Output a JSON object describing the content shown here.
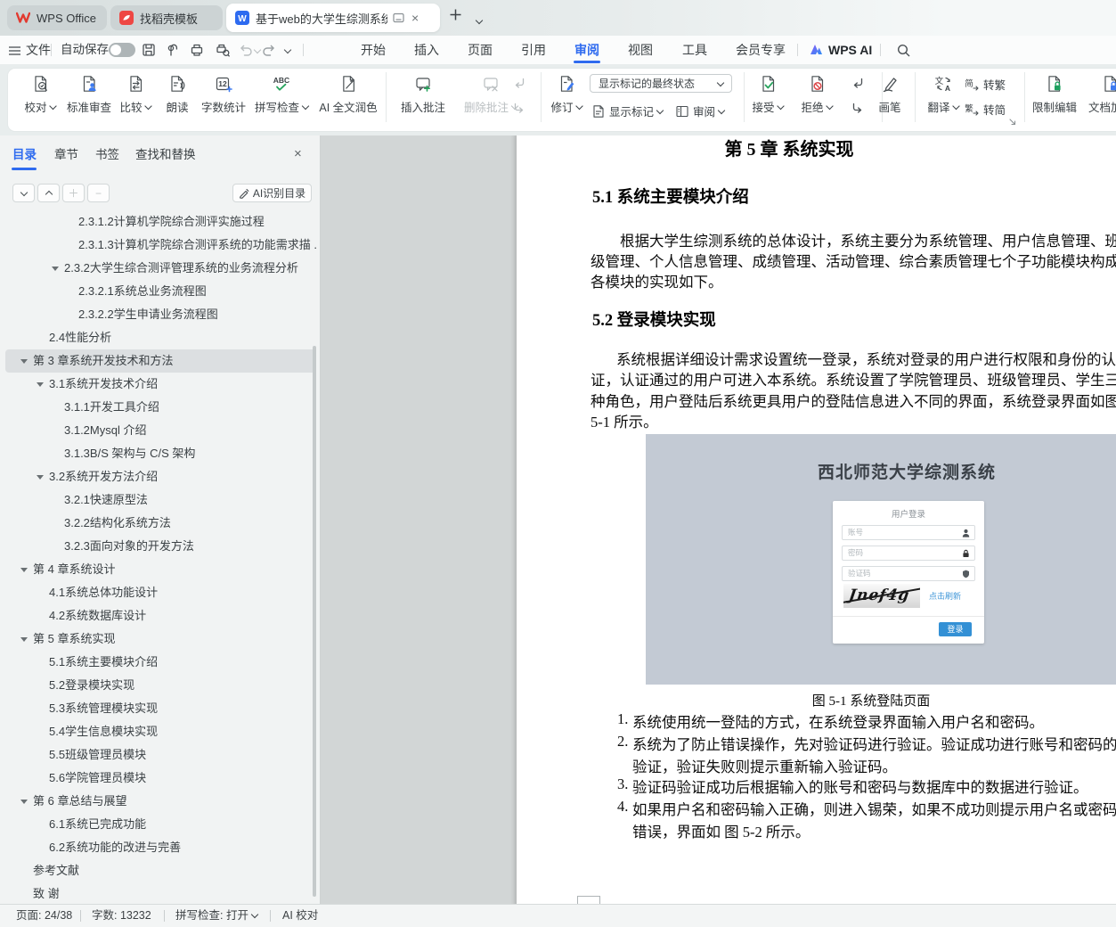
{
  "tabbar": {
    "home": "WPS Office",
    "docer": "找稻壳模板",
    "doc": "基于web的大学生综测系统设"
  },
  "menubar": {
    "file": "文件",
    "autosave": "自动保存",
    "menus": [
      "开始",
      "插入",
      "页面",
      "引用",
      "审阅",
      "视图",
      "工具",
      "会员专享"
    ],
    "active": "审阅",
    "wps_ai": "WPS AI"
  },
  "ribbon": {
    "proofread": "校对",
    "standard_review": "标准审查",
    "compare": "比较",
    "read_aloud": "朗读",
    "word_count": "字数统计",
    "spell_check": "拼写检查",
    "ai_polish": "AI 全文润色",
    "insert_comment": "插入批注",
    "delete_comment": "删除批注",
    "revisions": "修订",
    "markup_state": "显示标记的最终状态",
    "show_markup": "显示标记",
    "review": "审阅",
    "accept": "接受",
    "reject": "拒绝",
    "pen": "画笔",
    "translate": "翻译",
    "to_traditional": "转繁",
    "to_simplified": "转简",
    "restrict_editing": "限制编辑",
    "doc_encrypt": "文档加密"
  },
  "sidebar": {
    "tabs": [
      "目录",
      "章节",
      "书签",
      "查找和替换"
    ],
    "active_tab": "目录",
    "ai_button": "AI识别目录",
    "toc": [
      {
        "t": "2.3.1.2计算机学院综合测评实施过程",
        "lv": 4
      },
      {
        "t": "2.3.1.3计算机学院综合测评系统的功能需求描 ...",
        "lv": 4
      },
      {
        "t": "2.3.2大学生综合测评管理系统的业务流程分析",
        "lv": 3,
        "arrow": true
      },
      {
        "t": "2.3.2.1系统总业务流程图",
        "lv": 4
      },
      {
        "t": "2.3.2.2学生申请业务流程图",
        "lv": 4
      },
      {
        "t": "2.4性能分析",
        "lv": 2
      },
      {
        "t": "第 3 章系统开发技术和方法",
        "lv": 1,
        "arrow": true,
        "sel": true
      },
      {
        "t": "3.1系统开发技术介绍",
        "lv": 2,
        "arrow": true
      },
      {
        "t": "3.1.1开发工具介绍",
        "lv": 3
      },
      {
        "t": "3.1.2Mysql 介绍",
        "lv": 3
      },
      {
        "t": "3.1.3B/S 架构与 C/S 架构",
        "lv": 3
      },
      {
        "t": "3.2系统开发方法介绍",
        "lv": 2,
        "arrow": true
      },
      {
        "t": "3.2.1快速原型法",
        "lv": 3
      },
      {
        "t": "3.2.2结构化系统方法",
        "lv": 3
      },
      {
        "t": "3.2.3面向对象的开发方法",
        "lv": 3
      },
      {
        "t": "第 4 章系统设计",
        "lv": 1,
        "arrow": true
      },
      {
        "t": "4.1系统总体功能设计",
        "lv": 2
      },
      {
        "t": "4.2系统数据库设计",
        "lv": 2
      },
      {
        "t": "第 5 章系统实现",
        "lv": 1,
        "arrow": true
      },
      {
        "t": "5.1系统主要模块介绍",
        "lv": 2
      },
      {
        "t": "5.2登录模块实现",
        "lv": 2
      },
      {
        "t": "5.3系统管理模块实现",
        "lv": 2
      },
      {
        "t": "5.4学生信息模块实现",
        "lv": 2
      },
      {
        "t": "5.5班级管理员模块",
        "lv": 2
      },
      {
        "t": "5.6学院管理员模块",
        "lv": 2
      },
      {
        "t": "第 6 章总结与展望",
        "lv": 1,
        "arrow": true
      },
      {
        "t": "6.1系统已完成功能",
        "lv": 2
      },
      {
        "t": "6.2系统功能的改进与完善",
        "lv": 2
      },
      {
        "t": "参考文献",
        "lv": 1
      },
      {
        "t": "致 谢",
        "lv": 1
      }
    ]
  },
  "doc": {
    "chapter_title": "第 5 章 系统实现",
    "h51": "5.1 系统主要模块介绍",
    "p1": [
      "根据大学生综测系统的总体设计，系统主要分为系统管理、用户信息管理、班",
      "级管理、个人信息管理、成绩管理、活动管理、综合素质管理七个子功能模块构成，",
      "各模块的实现如下。"
    ],
    "h52": "5.2 登录模块实现",
    "p2": [
      "系统根据详细设计需求设置统一登录，系统对登录的用户进行权限和身份的认",
      "证，认证通过的用户可进入本系统。系统设置了学院管理员、班级管理员、学生三",
      "种角色，用户登陆后系统更具用户的登陆信息进入不同的界面，系统登录界面如图",
      "5-1 所示。"
    ],
    "fig_caption": "图 5-1 系统登陆页面",
    "list": [
      {
        "num": "1.",
        "l1": "系统使用统一登陆的方式，在系统登录界面输入用户名和密码。",
        "l2": ""
      },
      {
        "num": "2.",
        "l1": "系统为了防止错误操作，先对验证码进行验证。验证成功进行账号和密码的",
        "l2": "验证，验证失败则提示重新输入验证码。"
      },
      {
        "num": "3.",
        "l1": "验证码验证成功后根据输入的账号和密码与数据库中的数据进行验证。",
        "l2": ""
      },
      {
        "num": "4.",
        "l1": "如果用户名和密码输入正确，则进入锡荣，如果不成功则提示用户名或密码",
        "l2": "错误，界面如 图 5-2 所示。"
      }
    ]
  },
  "figure": {
    "title": "西北师范大学综测系统",
    "form_title": "用户登录",
    "account_placeholder": "账号",
    "password_placeholder": "密码",
    "captcha_placeholder": "验证码",
    "captcha_text": "Jnef4g",
    "refresh_link": "点击刷新",
    "login_button": "登录"
  },
  "statusbar": {
    "page": "页面: 24/38",
    "words": "字数: 13232",
    "spell": "拼写检查: 打开",
    "ai_proof": "AI 校对"
  }
}
